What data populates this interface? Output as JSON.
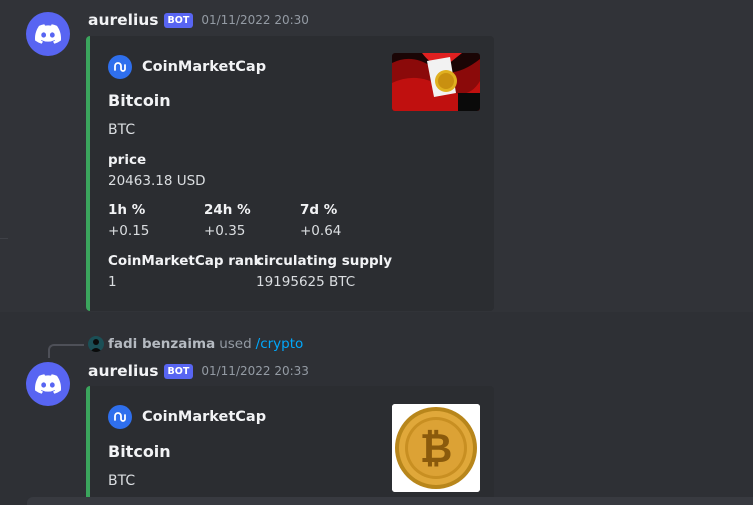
{
  "messages": [
    {
      "username": "aurelius",
      "bot_tag": "BOT",
      "timestamp": "01/11/2022 20:30",
      "embed": {
        "provider": "CoinMarketCap",
        "title": "Bitcoin",
        "description": "BTC",
        "price_label": "price",
        "price_value": "20463.18 USD",
        "h1_label": "1h %",
        "h1_value": "+0.15",
        "h24_label": "24h %",
        "h24_value": "+0.35",
        "d7_label": "7d %",
        "d7_value": "+0.64",
        "rank_label": "CoinMarketCap rank",
        "rank_value": "1",
        "supply_label": "circulating supply",
        "supply_value": "19195625 BTC"
      }
    },
    {
      "reply": {
        "user": "fadi benzaima",
        "used": "used",
        "command": "/crypto"
      },
      "username": "aurelius",
      "bot_tag": "BOT",
      "timestamp": "01/11/2022 20:33",
      "embed": {
        "provider": "CoinMarketCap",
        "title": "Bitcoin",
        "description": "BTC"
      }
    }
  ],
  "colors": {
    "background": "#313338",
    "embed_background": "#2b2d31",
    "embed_border": "#3ba55d",
    "blurple": "#5865f2",
    "link": "#00a8fc"
  },
  "icons": {
    "avatar": "discord-logo-icon",
    "provider": "coinmarketcap-icon"
  }
}
